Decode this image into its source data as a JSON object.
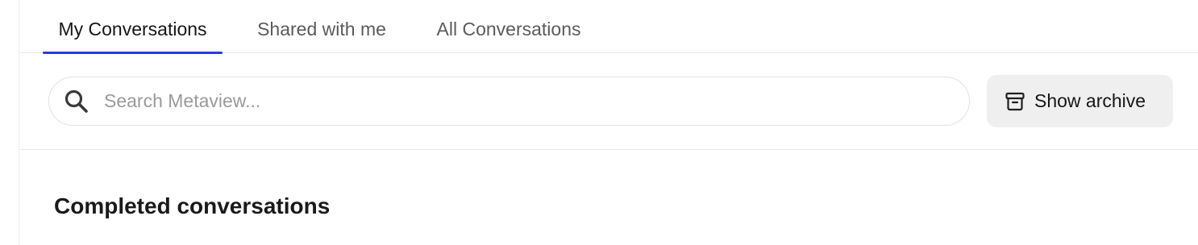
{
  "tabs": [
    {
      "label": "My Conversations",
      "active": true
    },
    {
      "label": "Shared with me",
      "active": false
    },
    {
      "label": "All Conversations",
      "active": false
    }
  ],
  "search": {
    "placeholder": "Search Metaview...",
    "value": "",
    "icon": "search-icon"
  },
  "archive_button": {
    "label": "Show archive",
    "icon": "archive-box-icon"
  },
  "section": {
    "title": "Completed conversations"
  },
  "colors": {
    "accent": "#2b3bd8",
    "button_bg": "#efefef",
    "border": "#e8e8e8"
  }
}
